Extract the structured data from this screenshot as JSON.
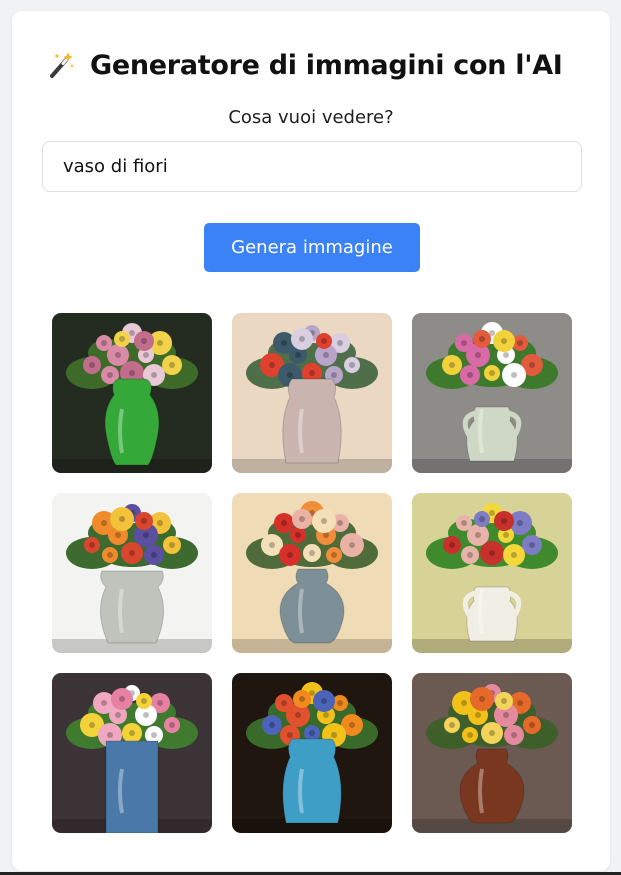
{
  "header": {
    "icon": "magic-wand-icon",
    "title": "Generatore di immagini con l'AI"
  },
  "prompt": {
    "label": "Cosa vuoi vedere?",
    "value": "vaso di fiori"
  },
  "generate_button": {
    "label": "Genera immagine",
    "color": "#3b82f6"
  },
  "gallery": {
    "images": [
      {
        "subject": "green vase with pink and yellow flowers",
        "bg": "#242b20",
        "vase": "#35a83a",
        "shape": "amphora",
        "flowers": [
          "#d98aa6",
          "#e9c9d6",
          "#f0d34a",
          "#c26d8c"
        ],
        "foliage": "#3f6b2a"
      },
      {
        "subject": "pink textured vase with red and blue flowers",
        "bg": "#ead8c2",
        "vase": "#c9b4b0",
        "shape": "tall",
        "flowers": [
          "#e0412e",
          "#3d5a6a",
          "#b8a5c9",
          "#d9cfe0"
        ],
        "foliage": "#4f6e4a"
      },
      {
        "subject": "white vase with colorful flowers",
        "bg": "#8d8c89",
        "vase": "#cfd8c6",
        "shape": "handles",
        "flowers": [
          "#e25b3c",
          "#f2d23c",
          "#d86aa6",
          "#ffffff"
        ],
        "foliage": "#3e7a2c"
      },
      {
        "subject": "stone vase with mixed bouquet",
        "bg": "#f3f3f2",
        "vase": "#bfc3bb",
        "shape": "urn",
        "flowers": [
          "#5b4fa0",
          "#f2c23b",
          "#d9462e",
          "#f08b2c"
        ],
        "foliage": "#3d6a2f"
      },
      {
        "subject": "grey blue ceramic vase with red flowers",
        "bg": "#efdcb6",
        "vase": "#7d8f97",
        "shape": "round",
        "flowers": [
          "#d5312a",
          "#f08c3a",
          "#e9b2a4",
          "#f3e0b9"
        ],
        "foliage": "#4f6b3a"
      },
      {
        "subject": "decorated white vase with dahlias",
        "bg": "#d7d296",
        "vase": "#f1eee6",
        "shape": "handles",
        "flowers": [
          "#c8302b",
          "#e8b3a8",
          "#f4d83a",
          "#7e7cc4"
        ],
        "foliage": "#3f8a2c"
      },
      {
        "subject": "tall blue cylinder vase with pink flowers",
        "bg": "#3c3336",
        "vase": "#4a78a8",
        "shape": "cylinder",
        "flowers": [
          "#e781a3",
          "#f4d23a",
          "#f0a8c0",
          "#ffffff"
        ],
        "foliage": "#3f7a2f"
      },
      {
        "subject": "multicolor glazed vase with sunflowers",
        "bg": "#1f160f",
        "vase": "#3f9ec6",
        "shape": "tall",
        "flowers": [
          "#f2c21b",
          "#f08a1e",
          "#4b63b8",
          "#e2512e"
        ],
        "foliage": "#3a6a2a"
      },
      {
        "subject": "brown pottery vase with yellow flowers",
        "bg": "#6a5a52",
        "vase": "#7a3720",
        "shape": "round",
        "flowers": [
          "#f2c21b",
          "#e58a9e",
          "#e56a2a",
          "#f3d35a"
        ],
        "foliage": "#3f5f2a"
      }
    ]
  }
}
